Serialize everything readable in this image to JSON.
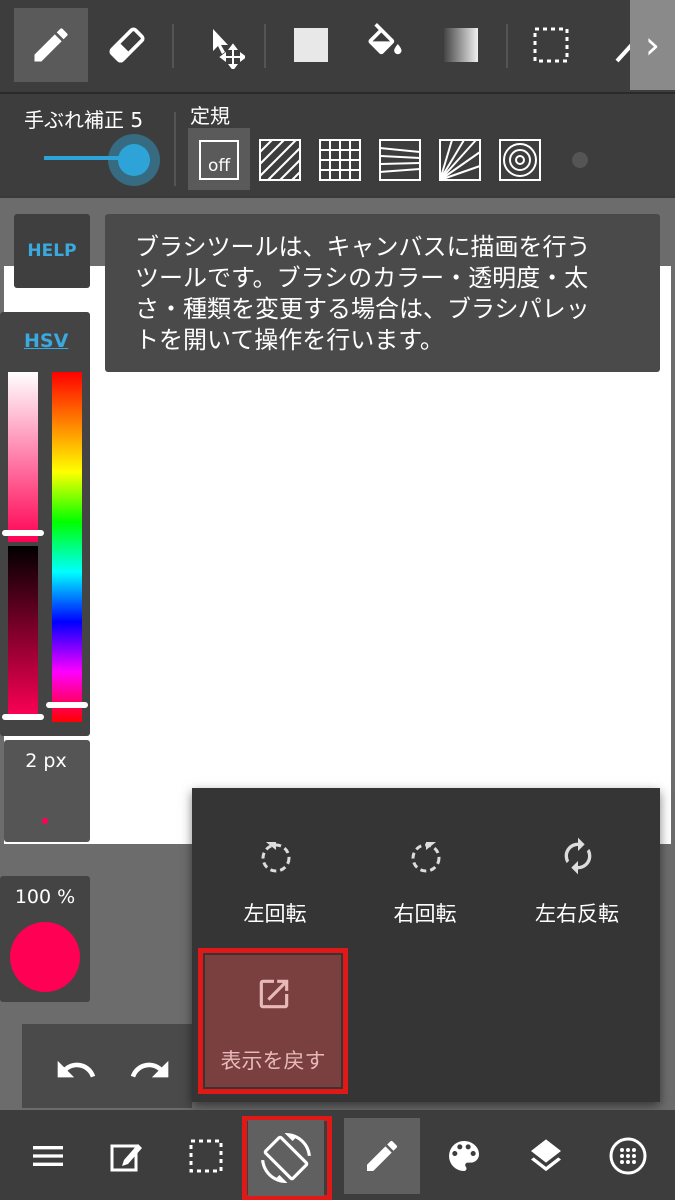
{
  "toolbar": {
    "tools": [
      "pen-tool",
      "eraser-tool",
      "move-tool",
      "fill-rect-tool",
      "bucket-tool",
      "gradient-tool",
      "select-tool",
      "magic-wand-tool"
    ],
    "more": "›"
  },
  "stabilizer": {
    "label": "手ぶれ補正 5",
    "value": 5
  },
  "ruler": {
    "label": "定規",
    "off_label": "off"
  },
  "help": {
    "button": "HELP",
    "text": "ブラシツールは、キャンバスに描画を行うツールです。ブラシのカラー・透明度・太さ・種類を変更する場合は、ブラシパレットを開いて操作を行います。"
  },
  "color": {
    "mode": "HSV",
    "current": "#FF0055"
  },
  "brush": {
    "size": "2 px",
    "opacity": "100 %"
  },
  "popup": {
    "rotate_left": "左回転",
    "rotate_right": "右回転",
    "flip": "左右反転",
    "reset_view": "表示を戻す"
  },
  "bottom": {
    "items": [
      "menu-icon",
      "edit-icon",
      "selection-icon",
      "rotate-screen-icon",
      "brush-icon",
      "palette-icon",
      "layers-icon",
      "material-icon"
    ]
  },
  "colors": {
    "accent": "#2ea3d8",
    "highlight": "#e01818"
  }
}
